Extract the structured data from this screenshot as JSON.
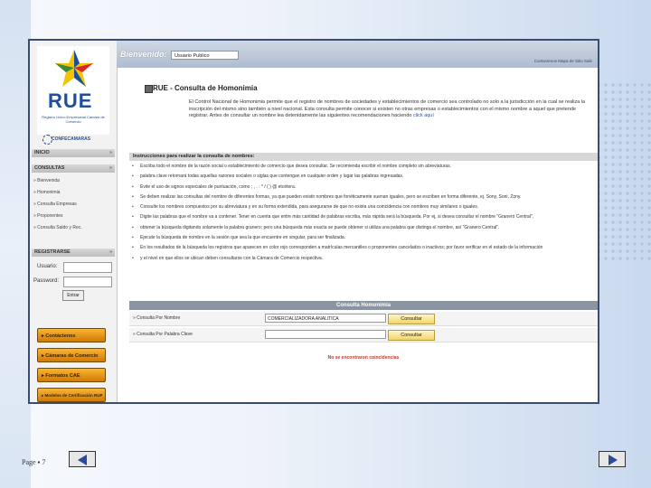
{
  "topbar": {
    "welcome_label": "Bienvenido:",
    "user_value": "Usuario Publico",
    "links": "Contactenos   Mapa de Sitio   Salir"
  },
  "sidebar": {
    "logo_text": "RUE",
    "logo_subtitle": "Registro Único Empresarial Cámara de Comercio",
    "partner": "CONFECAMARAS",
    "sections": [
      {
        "label": "INICIO"
      },
      {
        "label": "CONSULTAS"
      }
    ],
    "consult_items": [
      "Bienvenida",
      "Homonimia",
      "Consulta Empresas",
      "Proponentes",
      "Consulta Saldo y Rec."
    ],
    "register_section": "REGISTRARSE",
    "login": {
      "user_label": "Usuario:",
      "password_label": "Password:",
      "submit": "Entrar"
    },
    "orange_buttons": [
      "Contáctenos",
      "Cámaras de Comercio",
      "Formatos CAE",
      "Modelos de Certificación RUP"
    ]
  },
  "content": {
    "title": "RUE - Consulta de Homonimia",
    "intro": "El Control Nacional de Homonimia permite que el registro de nombres de sociedades y establecimientos de comercio sea controlado no solo a la jurisdicción en la cual se realiza la inscripción del mismo sino también a nivel nacional. Esta consulta permite conocer si existen no otras empresas o establecimientos con el mismo nombre a aquel que pretende registrar. Antes de consultar un nombre lea detenidamente las siguientes recomendaciones haciendo",
    "intro_link": "click aquí",
    "instructions_header": "Instrucciones para realizar la consulta de nombres:",
    "instructions": [
      "Escriba todo el nombre de la razón social o establecimiento de comercio que desea consultar. Se recomienda escribir el nombre completo sin abreviaturas.",
      "palabra clave retornará todas aquellas razones sociales o siglas que contengan en cualquier orden y lugar las palabras ingresadas.",
      "Evite el uso de signos especiales de puntuación, como ; , . : * / ( ) @ etcétera.",
      "Se deben realizar las consultas del nombre de diferentes formas, ya que pueden existir nombres que fonéticamente suenan iguales, pero se escriben en forma diferente, ej. Sony, Soni, Zony.",
      "Consulte los nombres compuestos por su abreviatura y en su forma extendida, para asegurarse de que no exista una coincidencia con nombres muy similares o iguales.",
      "Digite las palabras que el nombre va a contener. Tener en cuenta que entre más cantidad de palabras escriba, más rápida será la búsqueda. Por ej, si desea consultar el nombre \"Granero Central\",",
      "obtener la búsqueda digitando solamente la palabra granero; pero una búsqueda más exacta se puede obtener si utiliza una palabra que distinga el nombre, así \"Granero Central\".",
      "Ejecute la búsqueda de nombre en la sesión que sea la que encuentre en singular, para ser finalizada.",
      "En los resultados de la búsqueda los registros que aparecen en color rojo corresponden a matrículas mercantiles o proponentes cancelados o inactivos; por favor verificar en el estado de la información",
      "y el nivel en que ellos se ubican deben consultarse con la Cámara de Comercio respectiva."
    ],
    "query_header": "Consulta Homonimia",
    "queries": [
      {
        "label": "Consulta Por Nombre",
        "value": "COMERCIALIZADORA ANALITICA",
        "button": "Consultar"
      },
      {
        "label": "Consulta Por Palabra Clave",
        "value": "",
        "button": "Consultar"
      }
    ],
    "no_results": "No se encontraron coincidencias"
  },
  "footer": {
    "page_label": "Page ▪ 7"
  },
  "colors": {
    "frame_border": "#3a4c74",
    "accent_blue": "#2b4a9c",
    "orange_button": "#f0a020"
  }
}
